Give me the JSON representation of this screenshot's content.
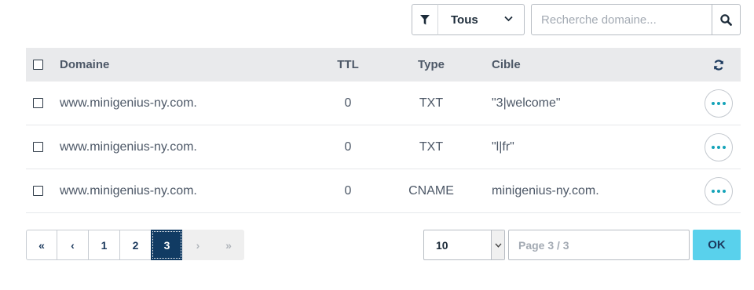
{
  "toolbar": {
    "filter_icon": "filter-icon",
    "filter_value": "Tous",
    "search_placeholder": "Recherche domaine...",
    "search_icon": "search-icon"
  },
  "table": {
    "headers": {
      "domain": "Domaine",
      "ttl": "TTL",
      "type": "Type",
      "target": "Cible"
    },
    "refresh_icon": "refresh-icon",
    "rows": [
      {
        "domain": "www.minigenius-ny.com.",
        "ttl": "0",
        "type": "TXT",
        "target": "\"3|welcome\""
      },
      {
        "domain": "www.minigenius-ny.com.",
        "ttl": "0",
        "type": "TXT",
        "target": "\"l|fr\""
      },
      {
        "domain": "www.minigenius-ny.com.",
        "ttl": "0",
        "type": "CNAME",
        "target": "minigenius-ny.com."
      }
    ]
  },
  "pagination": {
    "first": "«",
    "prev": "‹",
    "pages": [
      "1",
      "2",
      "3"
    ],
    "current_page": "3",
    "next": "›",
    "last": "»"
  },
  "page_size": {
    "value": "10"
  },
  "page_jump": {
    "placeholder": "Page 3 / 3",
    "button_label": "OK"
  },
  "colors": {
    "active_page": "#113b63",
    "ok_button": "#59d1ec",
    "more_dots": "#14a3b8",
    "header_bg": "#e9eaec"
  }
}
